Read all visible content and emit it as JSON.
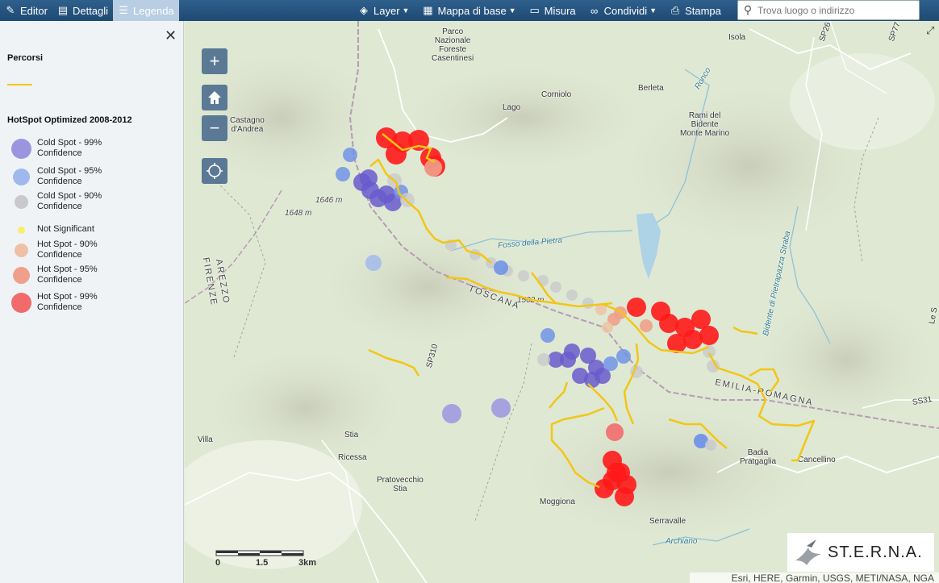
{
  "toolbar": {
    "editor": "Editor",
    "details": "Dettagli",
    "legend": "Legenda",
    "layer": "Layer",
    "basemap": "Mappa di base",
    "measure": "Misura",
    "share": "Condividi",
    "print": "Stampa",
    "search_placeholder": "Trova luogo o indirizzo"
  },
  "legend": {
    "routes_title": "Percorsi",
    "routes_color": "#f2c617",
    "hotspot_title": "HotSpot Optimized 2008-2012",
    "items": [
      {
        "line1": "Cold Spot - 99%",
        "line2": "Confidence",
        "color": "#9b95e0",
        "size": 25
      },
      {
        "line1": "Cold Spot - 95%",
        "line2": "Confidence",
        "color": "#9fb8ee",
        "size": 21
      },
      {
        "line1": "Cold Spot - 90%",
        "line2": "Confidence",
        "color": "#c9c9cc",
        "size": 17
      },
      {
        "line1": "Not Significant",
        "line2": "",
        "color": "#f6f06a",
        "size": 9
      },
      {
        "line1": "Hot Spot - 90%",
        "line2": "Confidence",
        "color": "#eec0a5",
        "size": 17
      },
      {
        "line1": "Hot Spot - 95%",
        "line2": "Confidence",
        "color": "#f0a08a",
        "size": 21
      },
      {
        "line1": "Hot Spot - 99%",
        "line2": "Confidence",
        "color": "#f26b6b",
        "size": 25
      }
    ]
  },
  "map": {
    "places": {
      "parco": "Parco\nNazionale\nForeste\nCasentinesi",
      "isola": "Isola",
      "corniolo": "Corniolo",
      "berleta": "Berleta",
      "lago": "Lago",
      "ronco": "Ronco",
      "rami": "Rami del\nBidente\nMonte Marino",
      "castagno": "Castagno\nd'Andrea",
      "m1646": "1646 m",
      "m1648": "1648 m",
      "fosso": "Fosso della Pietra",
      "arezzo": "AREZZO",
      "firenze": "FIRENZE",
      "toscana": "TOSCANA",
      "m1502": "1502 m",
      "sp310": "SP310",
      "emilia": "EMILIA-ROMAGNA",
      "bidente": "Bidente di Pietrapazza Straba",
      "villa": "Villa",
      "stia": "Stia",
      "ricessa": "Ricessa",
      "pratovecchio": "Pratovecchio\nStia",
      "moggiona": "Moggiona",
      "serravalle": "Serravalle",
      "archiano": "Archiano",
      "badia": "Badia\nPratgaglia",
      "cancellino": "Cancellino",
      "sp26": "SP26",
      "sp77": "SP77",
      "ss31": "SS31",
      "les": "Le S"
    },
    "scale": {
      "l0": "0",
      "l1": "1.5",
      "l2": "3km"
    },
    "logo": "ST.E.R.N.A.",
    "attribution": "Esri, HERE, Garmin, USGS, METI/NASA, NGA"
  }
}
